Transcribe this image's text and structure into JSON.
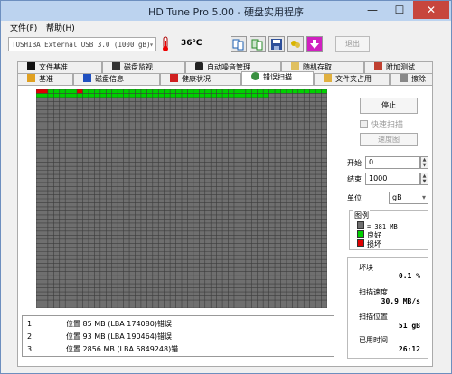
{
  "window": {
    "title": "HD Tune Pro 5.00 - 硬盘实用程序",
    "minimize": "—",
    "maximize": "☐",
    "close": "✕"
  },
  "menu": {
    "file": "文件(F)",
    "help": "帮助(H)"
  },
  "toolbar": {
    "drive": "TOSHIBA External USB 3.0 (1000 gB)",
    "temperature": "36℃",
    "exit": "退出"
  },
  "tabs_top": [
    "文件基准",
    "磁盘监视",
    "自动噪音管理",
    "随机存取",
    "附加测试"
  ],
  "tabs_bottom": [
    "基准",
    "磁盘信息",
    "健康状况",
    "错误扫描",
    "文件夹占用",
    "擦除"
  ],
  "active_tab": "错误扫描",
  "scan": {
    "stop_label": "停止",
    "quick_scan_label": "快速扫描",
    "speed_map_label": "速度图",
    "start_label": "开始",
    "start_value": "0",
    "end_label": "结束",
    "end_value": "1000",
    "unit_label": "单位",
    "unit_value": "gB",
    "legend_title": "图例",
    "legend_block": "= 381 MB",
    "legend_good": "良好",
    "legend_bad": "损坏",
    "colors": {
      "good": "#00d000",
      "bad": "#e00000",
      "unscanned": "#6f6f6f",
      "grid_line": "#3c3c3c"
    },
    "grid": {
      "cols": 50,
      "rows": 54,
      "scanned_blocks": 90,
      "bad_blocks": [
        0,
        1,
        7
      ]
    }
  },
  "stats": {
    "damaged_label": "坏块",
    "damaged_value": "0.1 %",
    "speed_label": "扫描速度",
    "speed_value": "30.9 MB/s",
    "position_label": "扫描位置",
    "position_value": "51 gB",
    "time_label": "已用时间",
    "time_value": "26:12"
  },
  "errors": [
    {
      "n": "1",
      "text": "位置 85 MB (LBA 174080)错误"
    },
    {
      "n": "2",
      "text": "位置 93 MB (LBA 190464)错误"
    },
    {
      "n": "3",
      "text": "位置 2856 MB (LBA 5849248)错..."
    }
  ]
}
